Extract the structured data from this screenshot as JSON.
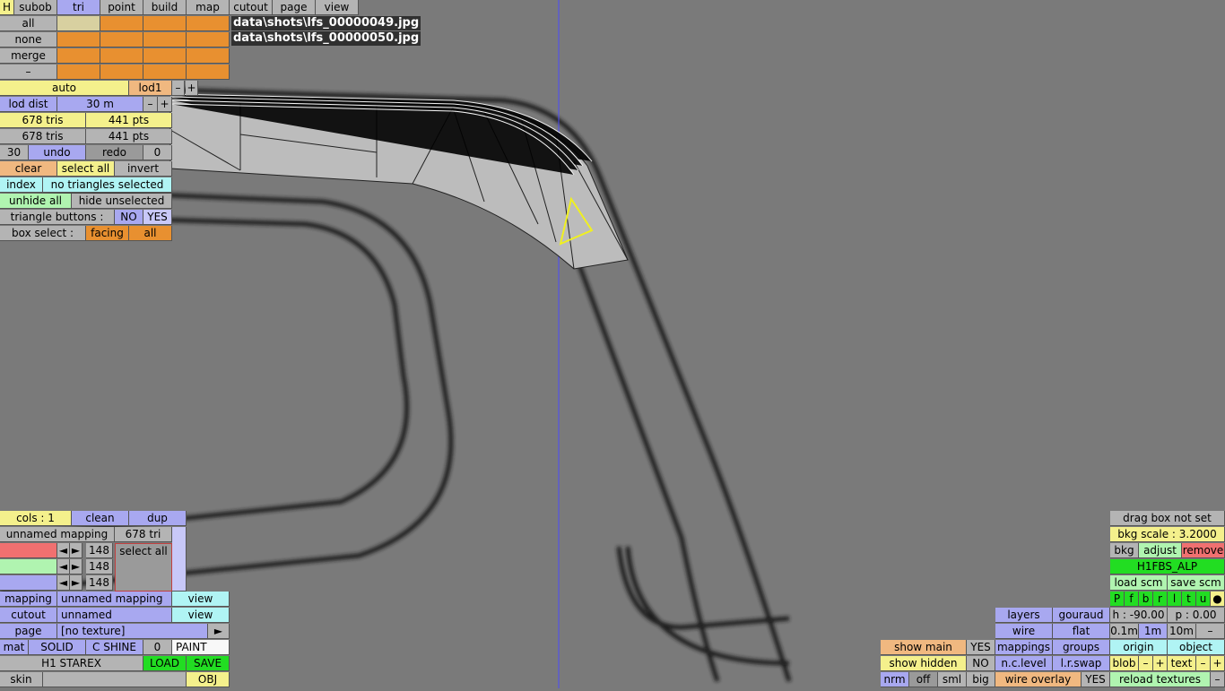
{
  "menu": {
    "h": "H",
    "tabs": [
      "subob",
      "tri",
      "point",
      "build",
      "map",
      "cutout",
      "page",
      "view"
    ]
  },
  "rows": {
    "all": "all",
    "none": "none",
    "merge": "merge",
    "dash": "–"
  },
  "shots": [
    "data\\shots\\lfs_00000049.jpg",
    "data\\shots\\lfs_00000050.jpg"
  ],
  "lod": {
    "auto": "auto",
    "lod1": "lod1",
    "minus": "–",
    "plus": "+",
    "dist_label": "lod dist",
    "dist_val": "30 m"
  },
  "stats": {
    "tris1": "678 tris",
    "pts1": "441 pts",
    "tris2": "678 tris",
    "pts2": "441 pts"
  },
  "undo": {
    "n": "30",
    "undo": "undo",
    "redo": "redo",
    "z": "0"
  },
  "sel": {
    "clear": "clear",
    "select_all": "select all",
    "invert": "invert",
    "index": "index",
    "none_sel": "no triangles selected",
    "unhide": "unhide all",
    "hide_unsel": "hide unselected",
    "tri_btn": "triangle buttons :",
    "no": "NO",
    "yes": "YES",
    "box": "box select :",
    "facing": "facing",
    "all": "all"
  },
  "bl": {
    "cols": "cols : 1",
    "clean": "clean",
    "dup": "dup",
    "mapname": "unnamed mapping",
    "tri": "678 tri",
    "v1": "148",
    "v2": "148",
    "v3": "148",
    "selall": "select all",
    "mapping": "mapping",
    "mapping_val": "unnamed mapping",
    "view": "view",
    "cutout": "cutout",
    "cutout_val": "unnamed",
    "view2": "view",
    "page": "page",
    "page_val": "[no texture]",
    "arrow": "►",
    "mat": "mat",
    "solid": "SOLID",
    "cshine": "C SHINE",
    "zero": "0",
    "paint": "PAINT",
    "name": "H1 STAREX",
    "load": "LOAD",
    "save": "SAVE",
    "skin": "skin",
    "obj": "OBJ",
    "left": "◄",
    "right": "►"
  },
  "br": {
    "dragbox": "drag box not set",
    "bkgscale": "bkg scale : 3.2000",
    "bkg": "bkg",
    "adjust": "adjust",
    "remove": "remove",
    "fname": "H1FBS_ALP",
    "loadscm": "load scm",
    "savescm": "save scm",
    "flags": [
      "P",
      "f",
      "b",
      "r",
      "l",
      "t",
      "u",
      "●"
    ],
    "layers": "layers",
    "gouraud": "gouraud",
    "h": "h : -90.00",
    "p": "p : 0.00",
    "wire": "wire",
    "flat": "flat",
    "s01": "0.1m",
    "s1": "1m",
    "s10": "10m",
    "sminus": "–",
    "showmain": "show main",
    "yes1": "YES",
    "mappings": "mappings",
    "groups": "groups",
    "origin": "origin",
    "object": "object",
    "showhidden": "show hidden",
    "no1": "NO",
    "nclevel": "n.c.level",
    "lrswap": "l.r.swap",
    "blob": "blob",
    "text": "text",
    "m": "–",
    "p2": "+",
    "nrm": "nrm",
    "off": "off",
    "sml": "sml",
    "big": "big",
    "wireov": "wire overlay",
    "yes2": "YES",
    "reload": "reload textures",
    "m2": "–"
  }
}
